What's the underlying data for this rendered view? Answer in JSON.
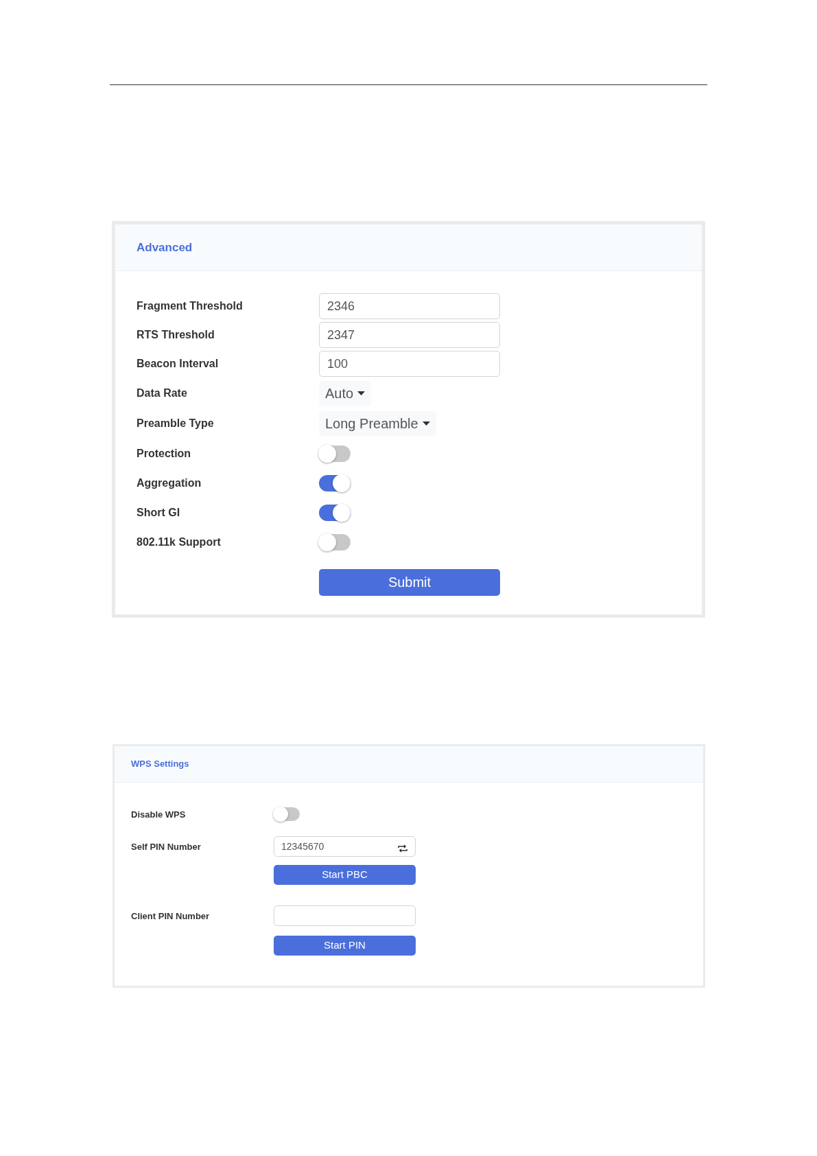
{
  "panels": [
    {
      "title": "Advanced",
      "rows": [
        {
          "kind": "input",
          "label": "Fragment Threshold",
          "value": "2346"
        },
        {
          "kind": "input",
          "label": "RTS Threshold",
          "value": "2347"
        },
        {
          "kind": "input",
          "label": "Beacon Interval",
          "value": "100"
        },
        {
          "kind": "select",
          "label": "Data Rate",
          "value": "Auto"
        },
        {
          "kind": "select",
          "label": "Preamble Type",
          "value": "Long Preamble"
        },
        {
          "kind": "toggle",
          "label": "Protection",
          "on": false
        },
        {
          "kind": "toggle",
          "label": "Aggregation",
          "on": true
        },
        {
          "kind": "toggle",
          "label": "Short GI",
          "on": true
        },
        {
          "kind": "toggle",
          "label": "802.11k Support",
          "on": false
        },
        {
          "kind": "button",
          "text": "Submit"
        }
      ]
    },
    {
      "title": "WPS Settings",
      "rows": [
        {
          "kind": "toggle",
          "label": "Disable WPS",
          "on": false
        },
        {
          "kind": "input_refresh",
          "label": "Self PIN Number",
          "value": "12345670"
        },
        {
          "kind": "button",
          "text": "Start PBC"
        },
        {
          "kind": "input",
          "label": "Client PIN Number"
        },
        {
          "kind": "button",
          "text": "Start PIN"
        }
      ]
    }
  ]
}
